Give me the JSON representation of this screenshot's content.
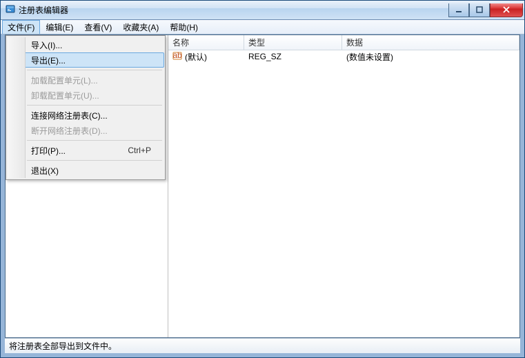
{
  "title": "注册表编辑器",
  "menubar": {
    "file": "文件(F)",
    "edit": "编辑(E)",
    "view": "查看(V)",
    "favorites": "收藏夹(A)",
    "help": "帮助(H)"
  },
  "file_menu": {
    "import": "导入(I)...",
    "export": "导出(E)...",
    "load_hive": "加载配置单元(L)...",
    "unload_hive": "卸载配置单元(U)...",
    "connect_network": "连接网络注册表(C)...",
    "disconnect_network": "断开网络注册表(D)...",
    "print": "打印(P)...",
    "print_shortcut": "Ctrl+P",
    "exit": "退出(X)"
  },
  "columns": {
    "name": "名称",
    "type": "类型",
    "data": "数据"
  },
  "rows": [
    {
      "name": "(默认)",
      "type": "REG_SZ",
      "data": "(数值未设置)"
    }
  ],
  "statusbar": "将注册表全部导出到文件中。"
}
